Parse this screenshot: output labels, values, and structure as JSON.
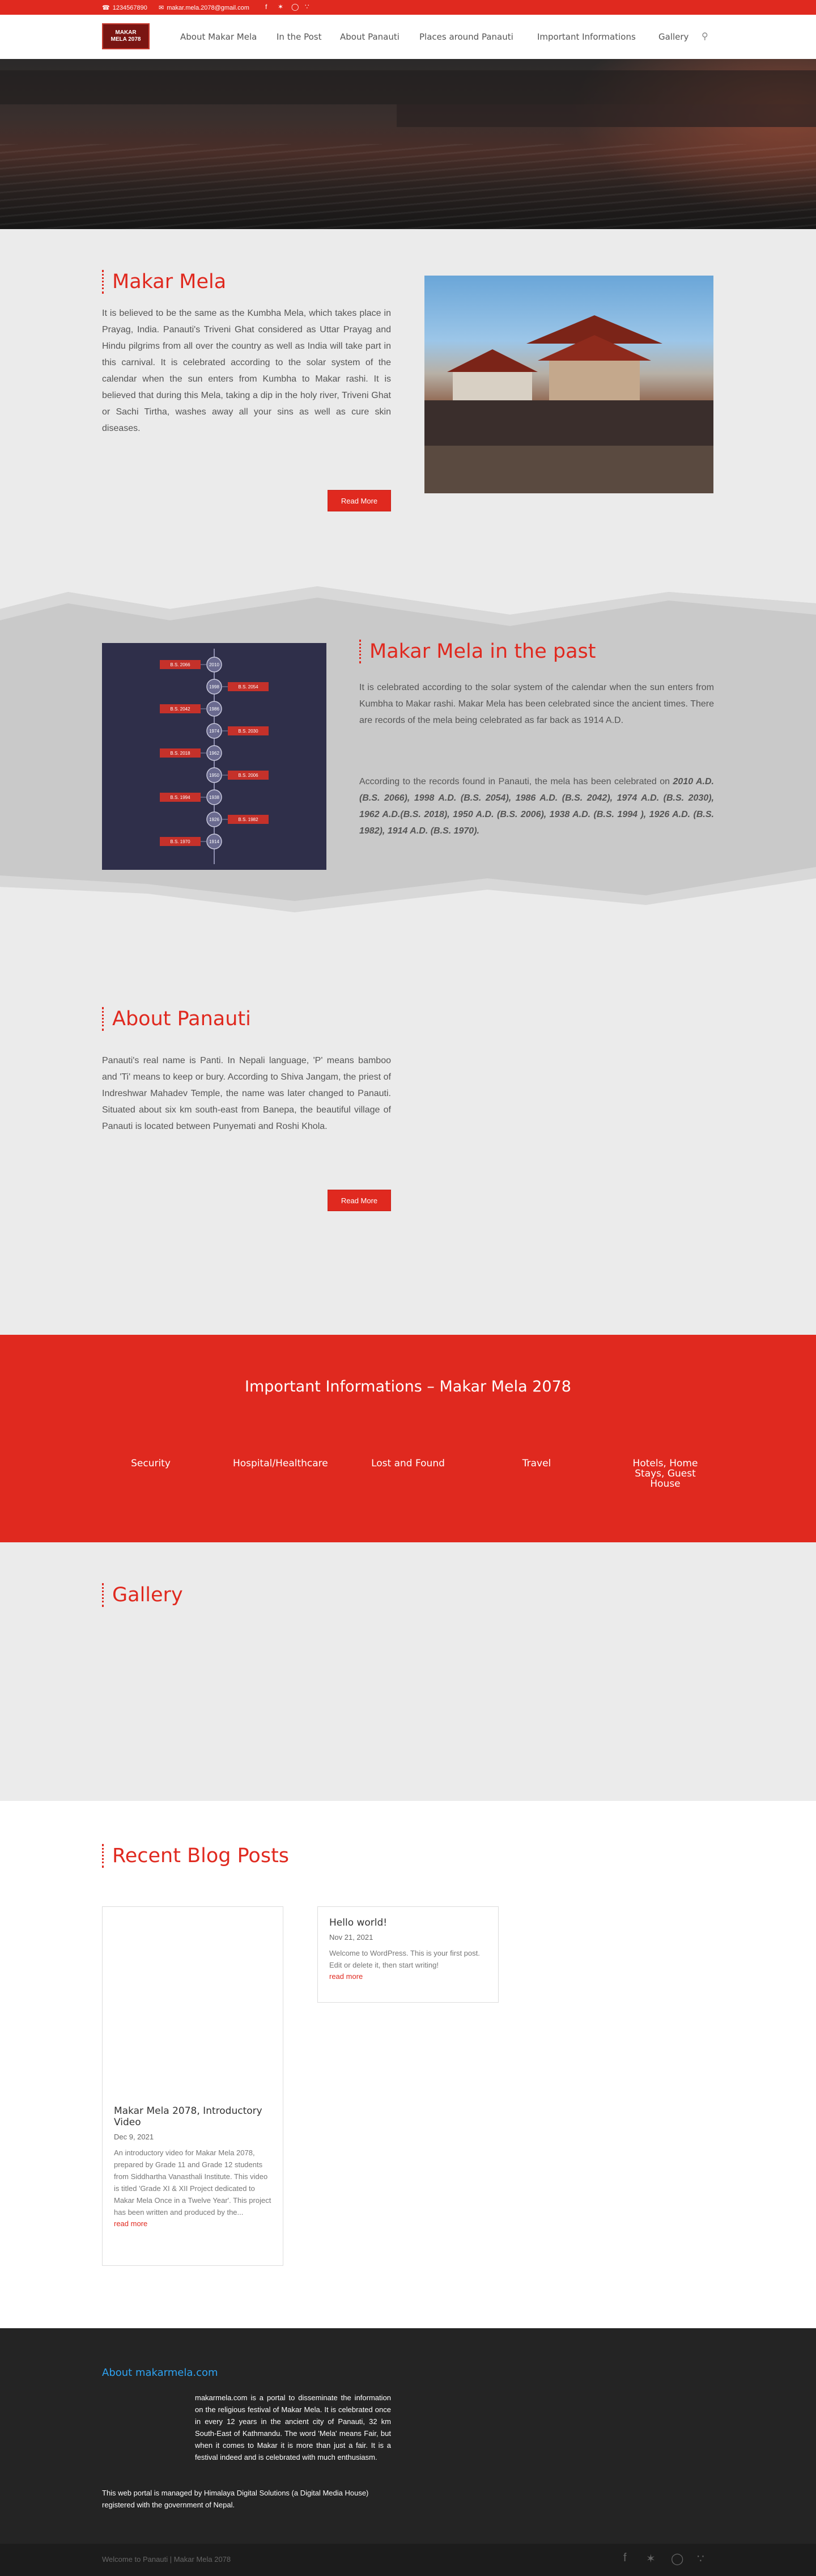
{
  "topbar": {
    "phone": "1234567890",
    "email": "makar.mela.2078@gmail.com"
  },
  "icons": {
    "phone": "phone-icon",
    "email": "envelope-icon",
    "facebook": "facebook-icon",
    "twitter": "twitter-icon",
    "instagram": "instagram-icon",
    "rss": "rss-icon",
    "search": "search-icon"
  },
  "logo": {
    "line1": "MAKAR",
    "line2": "MELA 2078"
  },
  "nav": {
    "items": [
      "About Makar Mela",
      "In the Post",
      "About Panauti",
      "Places around Panauti",
      "Important Informations",
      "Gallery"
    ]
  },
  "makar": {
    "title": "Makar Mela",
    "text": "It is believed to be the same as the Kumbha Mela, which takes place in Prayag, India. Panauti's Triveni Ghat considered as Uttar Prayag and Hindu pilgrims from all over the country as well as India will take part in this carnival. It is celebrated according to the solar system of the calendar when the sun enters from Kumbha to Makar rashi. It is believed that during this Mela, taking a dip in the holy river, Triveni Ghat or Sachi Tirtha, washes away all your sins as well as cure skin diseases.",
    "button": "Read More"
  },
  "past": {
    "title": "Makar Mela in the past",
    "p1": "It is celebrated according to the solar system of the calendar when the sun enters from Kumbha to Makar rashi. Makar Mela has been celebrated since the ancient times. There are records of the mela being celebrated as far back as 1914 A.D.",
    "p2_prefix": "According to the records found in Panauti, the mela has been celebrated on ",
    "p2_years": "2010 A.D. (B.S. 2066), 1998 A.D. (B.S. 2054), 1986 A.D. (B.S. 2042), 1974 A.D. (B.S. 2030),  1962 A.D.(B.S. 2018), 1950 A.D. (B.S. 2006), 1938 A.D. (B.S. 1994 ), 1926 A.D. (B.S. 1982), 1914 A.D. (B.S. 1970).",
    "timeline_left": [
      "B.S. 2066",
      "B.S. 2042",
      "B.S. 2018",
      "B.S. 1994",
      "B.S. 1970"
    ],
    "timeline_right": [
      "B.S. 2054",
      "B.S. 2030",
      "B.S. 2006",
      "B.S. 1982"
    ],
    "timeline_nodes": [
      "2010",
      "1998",
      "1986",
      "1974",
      "1962",
      "1950",
      "1938",
      "1926",
      "1914"
    ]
  },
  "panauti": {
    "title": "About Panauti",
    "text": "Panauti's real name is Panti. In Nepali language, 'P' means bamboo and 'Ti' means to keep or bury. According to Shiva Jangam, the priest of Indreshwar Mahadev Temple, the name was later changed to Panauti. Situated about six km south-east from Banepa, the beautiful village of Panauti is located between Punyemati and Roshi Khola.",
    "button": "Read More"
  },
  "important": {
    "title": "Important Informations – Makar Mela 2078",
    "items": [
      "Security",
      "Hospital/Healthcare",
      "Lost and Found",
      "Travel",
      "Hotels, Home Stays, Guest House"
    ]
  },
  "gallery": {
    "title": "Gallery"
  },
  "blog": {
    "title": "Recent Blog Posts",
    "posts": [
      {
        "title": "Makar Mela 2078, Introductory Video",
        "date": "Dec 9, 2021",
        "excerpt": "An introductory video for Makar Mela 2078, prepared by Grade 11 and Grade 12 students from Siddhartha Vanasthali Institute. This video is titled 'Grade XI & XII Project dedicated to Makar Mela Once in a Twelve Year'. This project has been written and produced by the...",
        "more": "read more"
      },
      {
        "title": "Hello world!",
        "date": "Nov 21, 2021",
        "excerpt": "Welcome to WordPress. This is your first post. Edit or delete it, then start writing!",
        "more": "read more"
      }
    ]
  },
  "footer": {
    "title": "About makarmela.com",
    "text": "makarmela.com is a portal to disseminate the information on the religious festival of Makar Mela. It is celebrated once in every 12 years in the ancient city of Panauti, 32 km South-East of Kathmandu. The word 'Mela' means Fair, but when it comes to Makar it is more than just a fair. It is a festival indeed and is celebrated with much enthusiasm.",
    "managed": "This web portal is managed by Himalaya Digital Solutions (a Digital Media House) registered with the government of Nepal.",
    "copyright": "Welcome to Panauti | Makar Mela 2078"
  },
  "colors": {
    "accent": "#e0291f",
    "dark": "#242424",
    "timeline_bg": "#2f2f4a"
  }
}
